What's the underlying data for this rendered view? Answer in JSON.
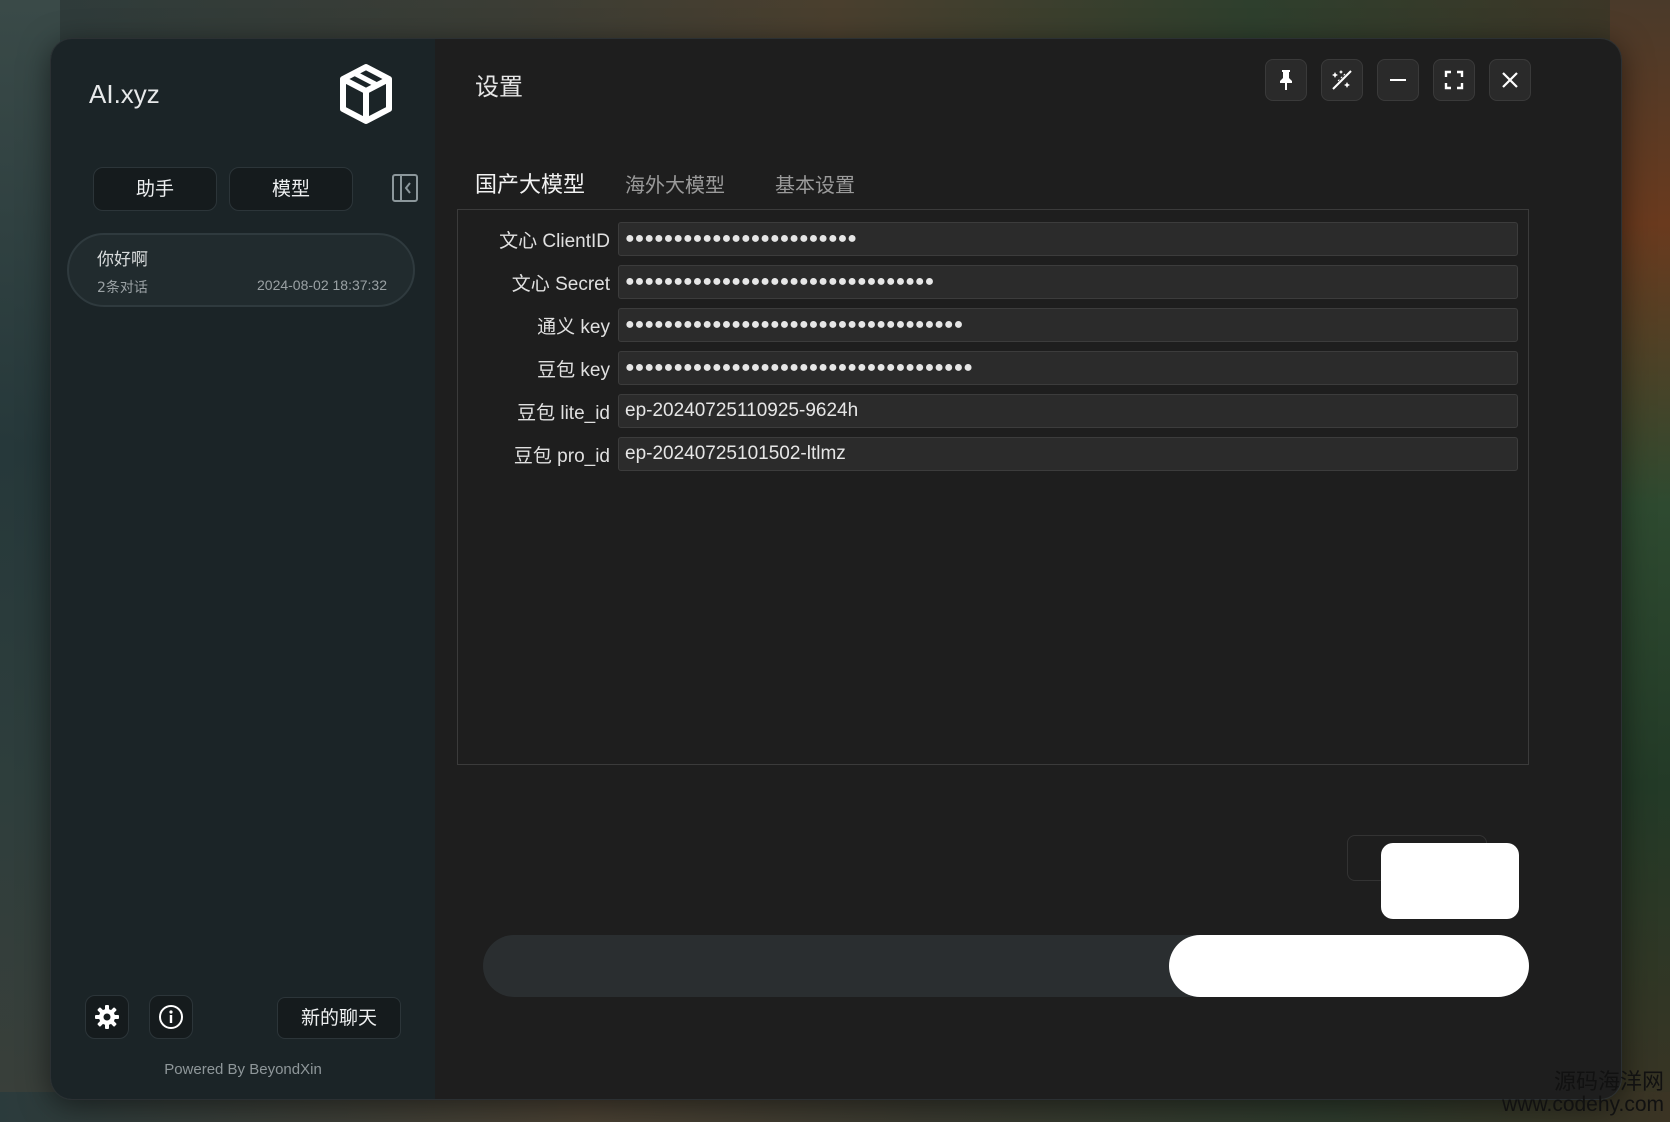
{
  "app": {
    "brand": "AI.xyz",
    "powered_by": "Powered By BeyondXin"
  },
  "sidebar": {
    "segments": [
      {
        "label": "助手"
      },
      {
        "label": "模型"
      }
    ],
    "chats": [
      {
        "title": "你好啊",
        "count": "2条对话",
        "time": "2024-08-02 18:37:32"
      }
    ],
    "new_chat_label": "新的聊天",
    "icons": [
      "cube-logo-icon",
      "collapse-sidebar-icon",
      "gear-icon",
      "info-icon"
    ]
  },
  "main": {
    "title": "设置",
    "window_controls": [
      "pin-icon",
      "magic-wand-icon",
      "minimize-icon",
      "fullscreen-icon",
      "close-icon"
    ],
    "tabs": [
      {
        "label": "国产大模型",
        "active": true
      },
      {
        "label": "海外大模型",
        "active": false
      },
      {
        "label": "基本设置",
        "active": false
      }
    ],
    "fields": [
      {
        "label": "文心 ClientID",
        "value": "●●●●●●●●●●●●●●●●●●●●●●●●",
        "secret": true
      },
      {
        "label": "文心 Secret",
        "value": "●●●●●●●●●●●●●●●●●●●●●●●●●●●●●●●●",
        "secret": true
      },
      {
        "label": "通义 key",
        "value": "●●●●●●●●●●●●●●●●●●●●●●●●●●●●●●●●●●●",
        "secret": true
      },
      {
        "label": "豆包 key",
        "value": "●●●●●●●●●●●●●●●●●●●●●●●●●●●●●●●●●●●●",
        "secret": true
      },
      {
        "label": "豆包 lite_id",
        "value": "ep-20240725110925-9624h",
        "secret": false
      },
      {
        "label": "豆包 pro_id",
        "value": "ep-20240725101502-ltlmz",
        "secret": false
      }
    ]
  },
  "watermark": {
    "line1": "源码海洋网",
    "line2": "www.codehy.com"
  },
  "colors": {
    "sidebar_bg": "#1b2427",
    "main_bg": "#1e1e1e",
    "input_bg": "#2b2b2b",
    "text": "#e6e6e6"
  }
}
